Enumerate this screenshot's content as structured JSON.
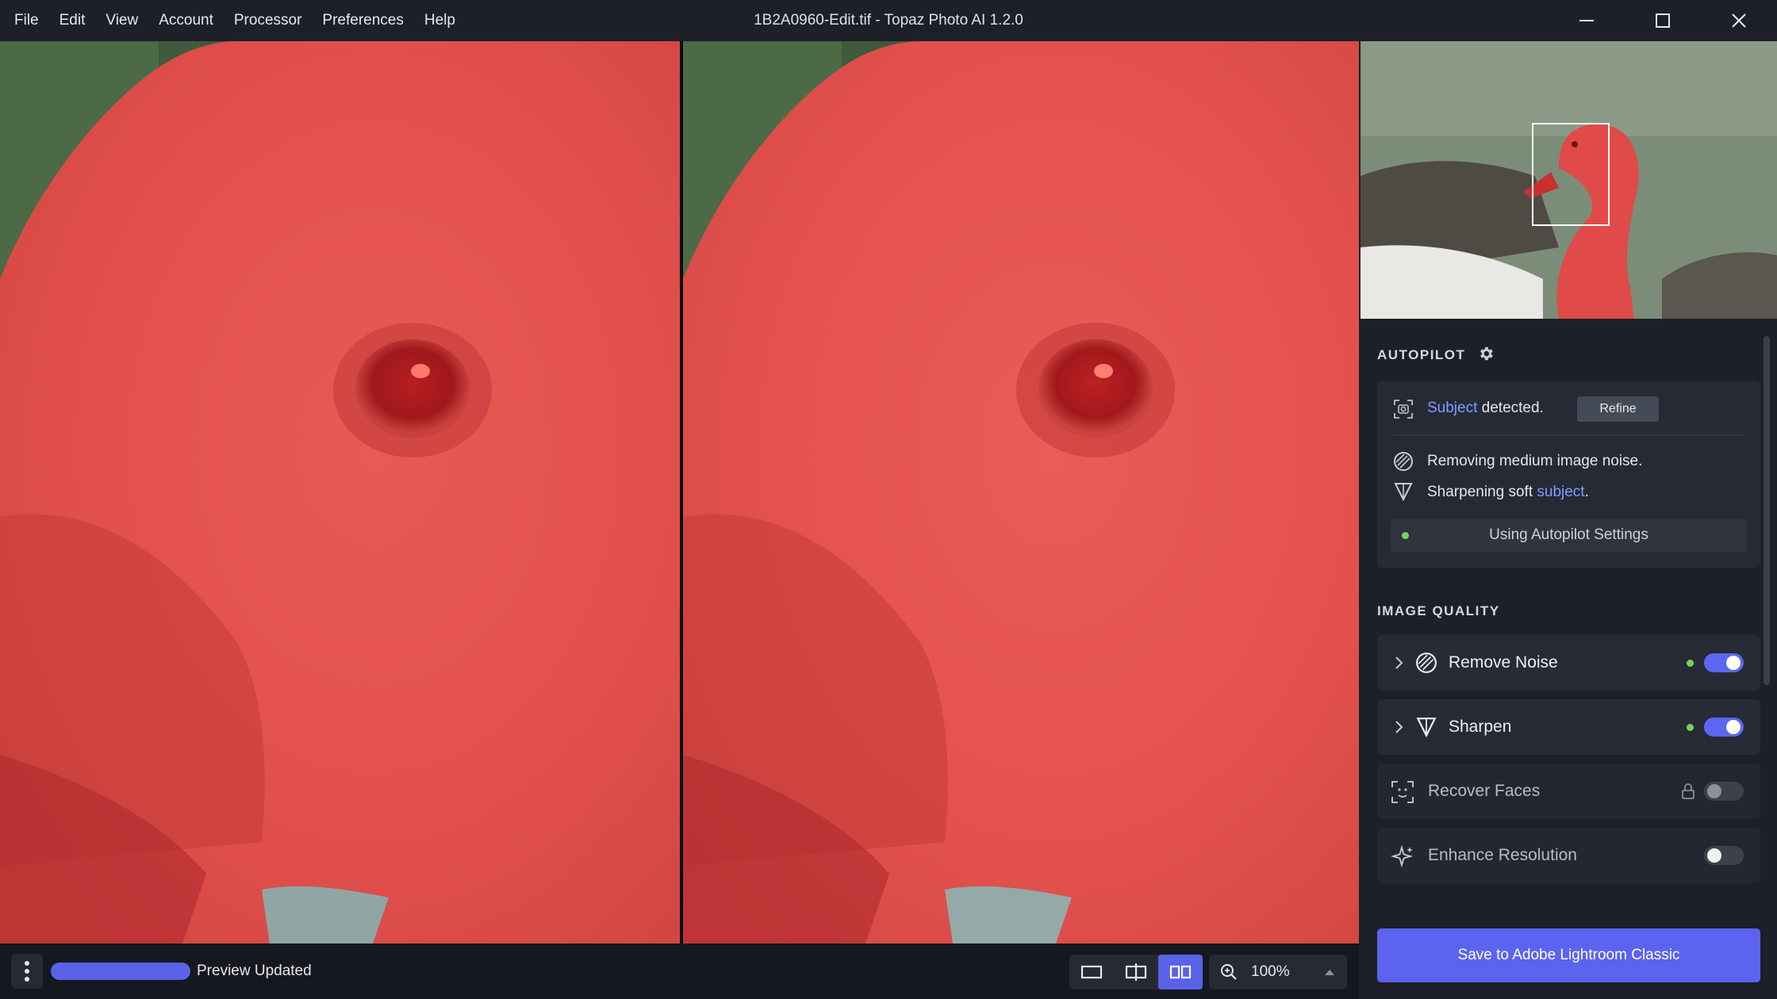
{
  "app": {
    "window_title": "1B2A0960-Edit.tif - Topaz Photo AI 1.2.0"
  },
  "menu": [
    "File",
    "Edit",
    "View",
    "Account",
    "Processor",
    "Preferences",
    "Help"
  ],
  "autopilot": {
    "title": "AUTOPILOT",
    "subject_link": "Subject",
    "subject_rest": " detected.",
    "refine_label": "Refine",
    "noise_text": "Removing medium image noise.",
    "sharpen_prefix": "Sharpening soft ",
    "sharpen_link": "subject",
    "sharpen_suffix": ".",
    "using_label": "Using Autopilot Settings"
  },
  "image_quality": {
    "title": "IMAGE QUALITY",
    "features": [
      {
        "name": "Remove Noise",
        "enabled": true
      },
      {
        "name": "Sharpen",
        "enabled": true
      },
      {
        "name": "Recover Faces",
        "enabled": false,
        "locked": true
      },
      {
        "name": "Enhance Resolution",
        "enabled": false
      }
    ]
  },
  "save_button": "Save to Adobe Lightroom Classic",
  "status": {
    "progress": 1.0,
    "label": "Preview Updated"
  },
  "zoom": {
    "value": "100%"
  },
  "colors": {
    "accent": "#5b63f0",
    "link": "#7f9cff",
    "active_dot": "#6fd65a",
    "overlay_red": "#e04a48"
  }
}
